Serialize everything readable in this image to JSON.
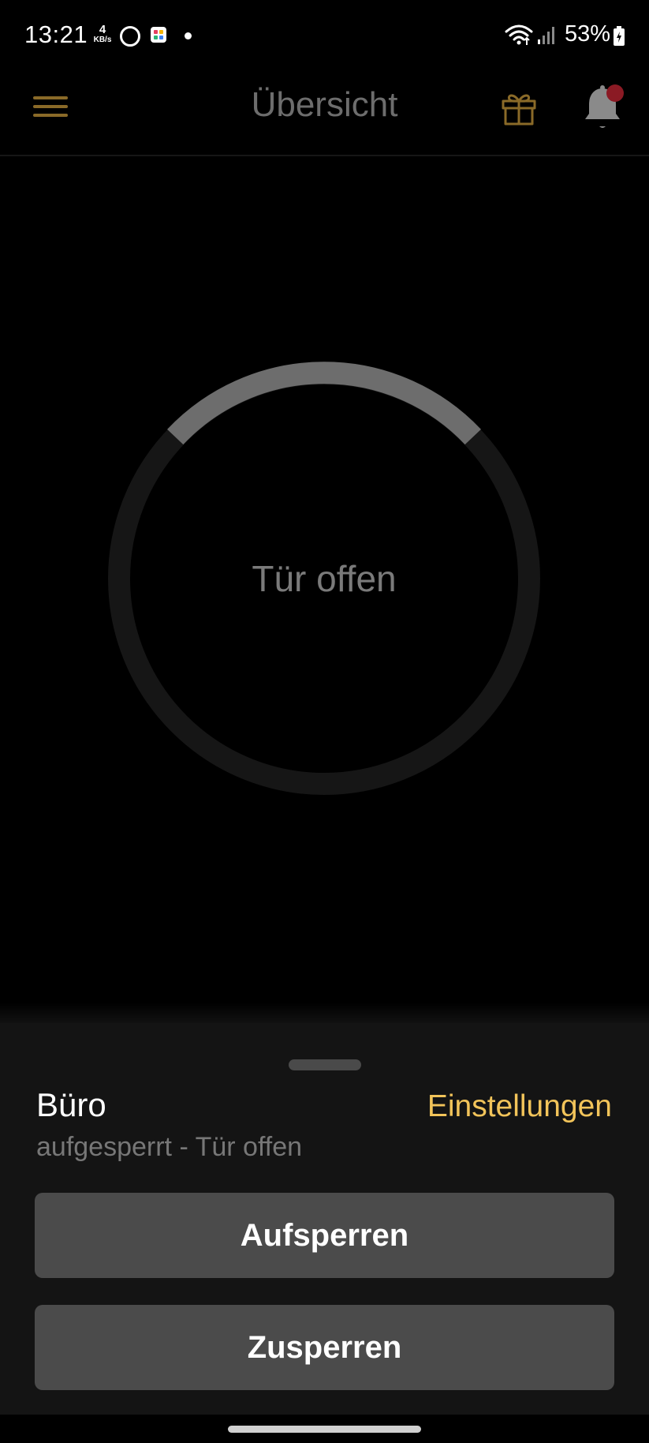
{
  "status_bar": {
    "time": "13:21",
    "net_speed_value": "4",
    "net_speed_unit": "KB/s",
    "battery": "53%",
    "icons": [
      "circle-notification-icon",
      "app-notification-icon",
      "dot-icon",
      "wifi-icon",
      "cell-signal-icon",
      "battery-charging-icon"
    ]
  },
  "app_bar": {
    "title": "Übersicht",
    "icons": [
      "menu-icon",
      "gift-icon",
      "notification-bell-icon"
    ],
    "accent_color": "#8a6a28",
    "badge_color": "#8b1a24"
  },
  "lock_status": {
    "label": "Tür offen",
    "ring_track_color": "#161616",
    "ring_progress_color": "#6d6d6d"
  },
  "sheet": {
    "device_name": "Büro",
    "device_status": "aufgesperrt - Tür offen",
    "settings_label": "Einstellungen",
    "settings_color": "#f2c45a",
    "unlock_label": "Aufsperren",
    "lock_label": "Zusperren"
  }
}
